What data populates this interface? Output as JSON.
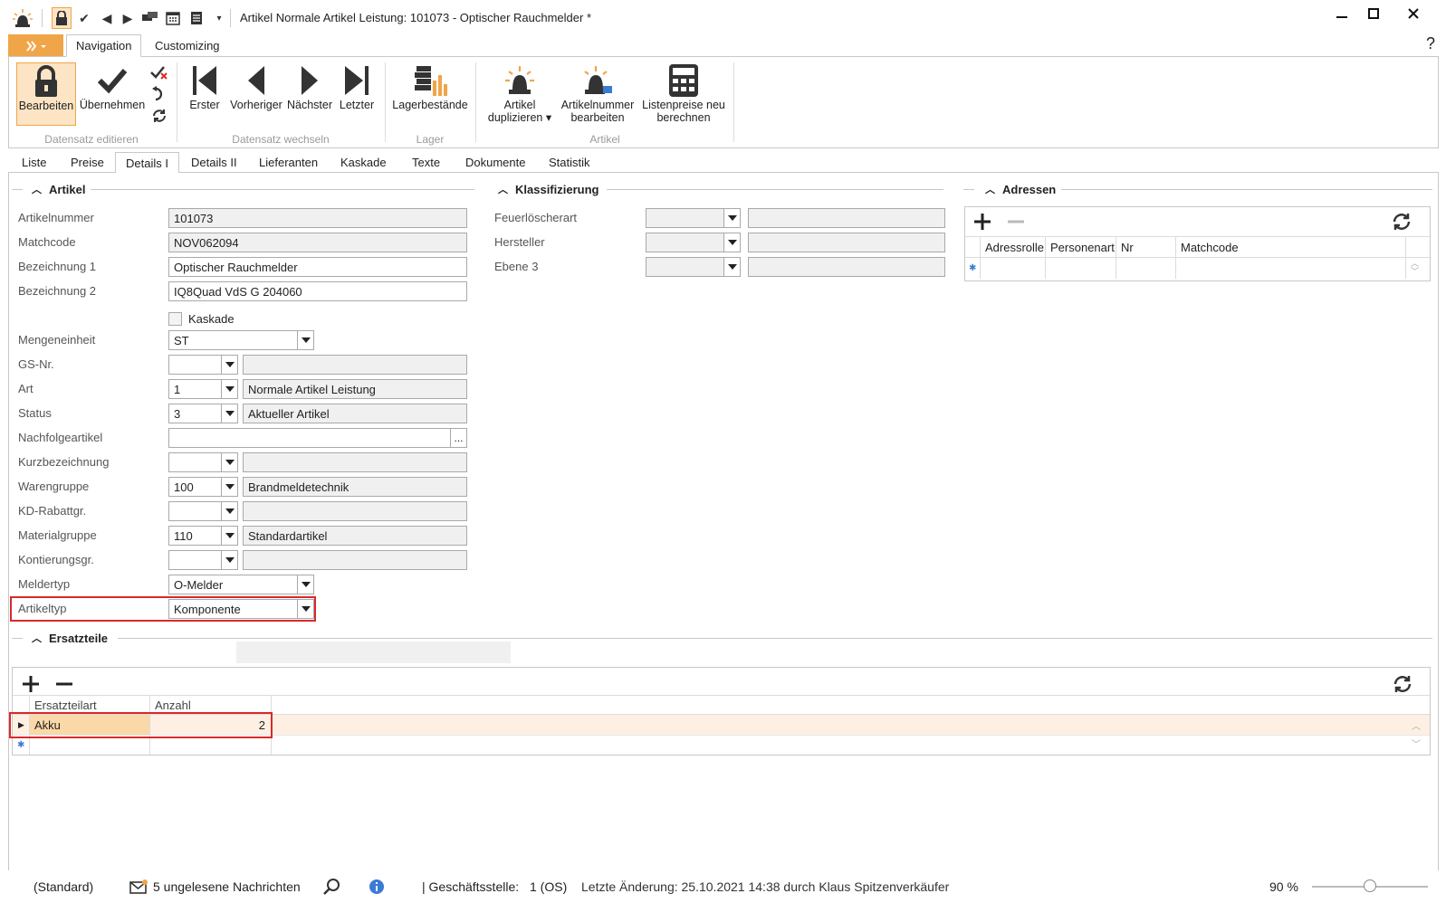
{
  "window": {
    "title": "Artikel Normale Artikel Leistung: 101073 - Optischer Rauchmelder *",
    "help": "?"
  },
  "ribbon_tabs": [
    "Navigation",
    "Customizing"
  ],
  "ribbon": {
    "bearbeiten": "Bearbeiten",
    "uebernehmen": "Übernehmen",
    "erster": "Erster",
    "vorheriger": "Vorheriger",
    "naechster": "Nächster",
    "letzter": "Letzter",
    "lagerbestaende": "Lagerbestände",
    "artikel_dup_1": "Artikel",
    "artikel_dup_2": "duplizieren ▾",
    "artnr_1": "Artikelnummer",
    "artnr_2": "bearbeiten",
    "listen_1": "Listenpreise neu",
    "listen_2": "berechnen",
    "grp_datensatz_editieren": "Datensatz editieren",
    "grp_datensatz_wechseln": "Datensatz wechseln",
    "grp_lager": "Lager",
    "grp_artikel": "Artikel"
  },
  "tabs": [
    "Liste",
    "Preise",
    "Details I",
    "Details II",
    "Lieferanten",
    "Kaskade",
    "Texte",
    "Dokumente",
    "Statistik"
  ],
  "artikel": {
    "header": "Artikel",
    "artikelnummer": {
      "label": "Artikelnummer",
      "value": "101073"
    },
    "matchcode": {
      "label": "Matchcode",
      "value": "NOV062094"
    },
    "bezeichnung1": {
      "label": "Bezeichnung 1",
      "value": "Optischer Rauchmelder"
    },
    "bezeichnung2": {
      "label": "Bezeichnung 2",
      "value": "IQ8Quad VdS G 204060"
    },
    "kaskade": "Kaskade",
    "mengeneinheit": {
      "label": "Mengeneinheit",
      "value": "ST"
    },
    "gsnr": {
      "label": "GS-Nr.",
      "code": "",
      "text": ""
    },
    "art": {
      "label": "Art",
      "code": "1",
      "text": "Normale Artikel Leistung"
    },
    "status": {
      "label": "Status",
      "code": "3",
      "text": "Aktueller Artikel"
    },
    "nachfolgeartikel": {
      "label": "Nachfolgeartikel",
      "value": "",
      "btn": "..."
    },
    "kurzbezeichnung": {
      "label": "Kurzbezeichnung",
      "code": "",
      "text": ""
    },
    "warengruppe": {
      "label": "Warengruppe",
      "code": "100",
      "text": "Brandmeldetechnik"
    },
    "kdrabatt": {
      "label": "KD-Rabattgr.",
      "code": "",
      "text": ""
    },
    "materialgruppe": {
      "label": "Materialgruppe",
      "code": "110",
      "text": "Standardartikel"
    },
    "kontierung": {
      "label": "Kontierungsgr.",
      "code": "",
      "text": ""
    },
    "meldertyp": {
      "label": "Meldertyp",
      "value": "O-Melder"
    },
    "artikeltyp": {
      "label": "Artikeltyp",
      "value": "Komponente"
    }
  },
  "klassifizierung": {
    "header": "Klassifizierung",
    "feuerloescherart": "Feuerlöscherart",
    "hersteller": "Hersteller",
    "ebene3": "Ebene 3"
  },
  "adressen": {
    "header": "Adressen",
    "columns": [
      "Adressrolle",
      "Personenart",
      "Nr",
      "Matchcode"
    ]
  },
  "ersatzteile": {
    "header": "Ersatzteile",
    "columns": [
      "Ersatzteilart",
      "Anzahl"
    ],
    "rows": [
      {
        "art": "Akku",
        "anzahl": "2"
      }
    ]
  },
  "status_bar": {
    "standard": "(Standard)",
    "messages": "5 ungelesene Nachrichten",
    "gs_label": "| Geschäftsstelle:",
    "gs_value": "1 (OS)",
    "last_change": "Letzte Änderung: 25.10.2021 14:38 durch Klaus Spitzenverkäufer",
    "zoom": "90 %",
    "zoom_level": 0.5
  }
}
